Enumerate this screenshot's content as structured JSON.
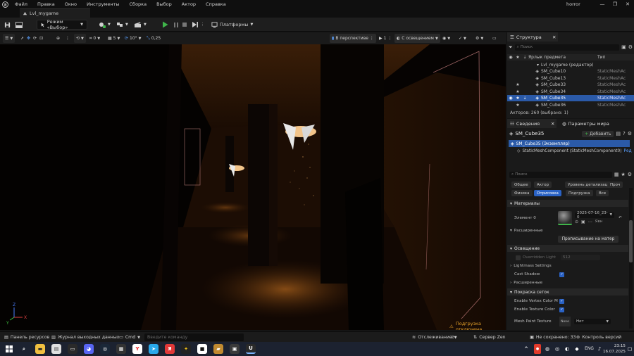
{
  "menu": {
    "items": [
      "Файл",
      "Правка",
      "Окно",
      "Инструменты",
      "Сборка",
      "Выбор",
      "Актор",
      "Справка"
    ],
    "project_name": "horror",
    "window_controls": [
      "—",
      "❐",
      "✕"
    ]
  },
  "level_tab": {
    "title": "Lvl_mygame"
  },
  "toolbar": {
    "mode_label": "Режим «Выбор»",
    "platforms_label": "Платформы"
  },
  "viewport_toolbar": {
    "snap_rotation": "0",
    "snap_grid": "5",
    "snap_angle": "10°",
    "snap_scale": "0,25",
    "view_mode": "В перспективе",
    "camera_speed": "1",
    "lighting": "С освещением",
    "loading_notice": "Подгрузка отключена"
  },
  "outliner": {
    "tab_label": "Структура",
    "search_placeholder": "Поиск",
    "col_label": "Ярлык предмета",
    "col_type": "Тип",
    "world_row": "Lvl_mygame (редактор)",
    "rows": [
      {
        "name": "SM_Cube10",
        "type": "StaticMeshAc",
        "star": false,
        "selected": false
      },
      {
        "name": "SM_Cube13",
        "type": "StaticMeshAc",
        "star": false,
        "selected": false
      },
      {
        "name": "SM_Cube33",
        "type": "StaticMeshAc",
        "star": true,
        "selected": false
      },
      {
        "name": "SM_Cube34",
        "type": "StaticMeshAc",
        "star": true,
        "selected": false
      },
      {
        "name": "SM_Cube35",
        "type": "StaticMeshAc",
        "star": true,
        "selected": true
      },
      {
        "name": "SM_Cube36",
        "type": "StaticMeshAc",
        "star": true,
        "selected": false
      }
    ],
    "actor_count": "Акторов: 260 (выбрано: 1)"
  },
  "details": {
    "tab_label": "Сведения",
    "world_tab_label": "Параметры мира",
    "object_name": "SM_Cube35",
    "add_button": "Добавить",
    "instance_row": "SM_Cube35 (Экземпляр)",
    "component_row": "StaticMeshComponent (StaticMeshComponent0)",
    "component_edit": "Ред",
    "search_placeholder": "Поиск",
    "filter_tabs_row1": [
      "Общее",
      "Актор",
      "Уровень детализации",
      "Проч"
    ],
    "filter_tabs_row2": [
      "Физика",
      "Отрисовка",
      "Подгрузка",
      "Все"
    ],
    "active_filter": "Отрисовка",
    "sections": {
      "materials": "Материалы",
      "lighting": "Освещение",
      "mesh_paint": "Покраска сеток"
    },
    "element_label": "Элемент 0",
    "material_value": "2025-07-16_23-0",
    "material_extra": "Явн",
    "advanced_label": "Расширенные",
    "material_button": "Прописывание на матер",
    "overridden_light": "Overridden Light",
    "overridden_light_value": "512",
    "lightmass": "Lightmass Settings",
    "cast_shadow": "Cast Shadow",
    "enable_vertex_color": "Enable Vertex Color M",
    "enable_texture_color": "Enable Texture Color",
    "mesh_paint_texture": "Mesh Paint Texture",
    "mesh_paint_value": "Нет",
    "mesh_paint_thumb": "None"
  },
  "statusbar": {
    "content_browser": "Панель ресурсов",
    "output_log": "Журнал выходных данных",
    "cmd": "Cmd",
    "cmd_placeholder": "Введите команду",
    "trace": "Отслеживание",
    "server": "Сервер Zen",
    "unsaved": "Не сохранено: 33",
    "source_control": "Контроль версий"
  },
  "taskbar": {
    "lang": "ENG",
    "time": "23:15",
    "date": "16.07.2025"
  },
  "colors": {
    "selection": "#2b5aa8",
    "accent_green": "#3fb54a",
    "warning": "#e5a12a"
  }
}
